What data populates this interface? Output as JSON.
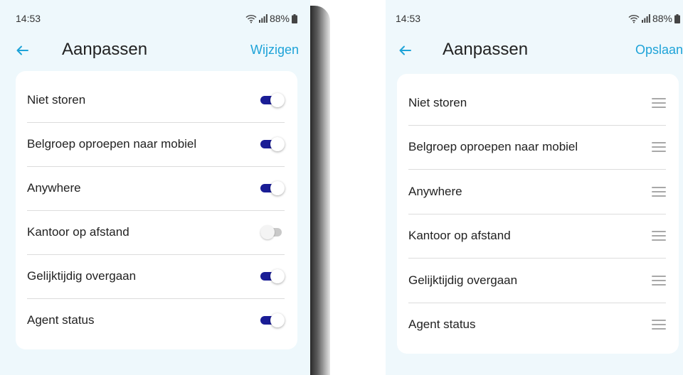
{
  "colors": {
    "accent": "#1ea3d8",
    "toggle_on": "#1a1d96",
    "toggle_off": "#c9c9c9",
    "background": "#eef8fc"
  },
  "left_screen": {
    "status": {
      "time": "14:53",
      "battery": "88%"
    },
    "header": {
      "title": "Aanpassen",
      "action_label": "Wijzigen"
    },
    "items": [
      {
        "label": "Niet storen",
        "enabled": true
      },
      {
        "label": "Belgroep oproepen naar mobiel",
        "enabled": true
      },
      {
        "label": "Anywhere",
        "enabled": true
      },
      {
        "label": "Kantoor op afstand",
        "enabled": false
      },
      {
        "label": "Gelijktijdig overgaan",
        "enabled": true
      },
      {
        "label": "Agent status",
        "enabled": true
      }
    ]
  },
  "right_screen": {
    "status": {
      "time": "14:53",
      "battery": "88%"
    },
    "header": {
      "title": "Aanpassen",
      "action_label": "Opslaan"
    },
    "items": [
      {
        "label": "Niet storen",
        "icon": "drag-handle-icon"
      },
      {
        "label": "Belgroep oproepen naar mobiel",
        "icon": "drag-handle-icon"
      },
      {
        "label": "Anywhere",
        "icon": "drag-handle-icon"
      },
      {
        "label": "Kantoor op afstand",
        "icon": "drag-handle-icon"
      },
      {
        "label": "Gelijktijdig overgaan",
        "icon": "drag-handle-icon"
      },
      {
        "label": "Agent status",
        "icon": "drag-handle-icon"
      }
    ]
  }
}
